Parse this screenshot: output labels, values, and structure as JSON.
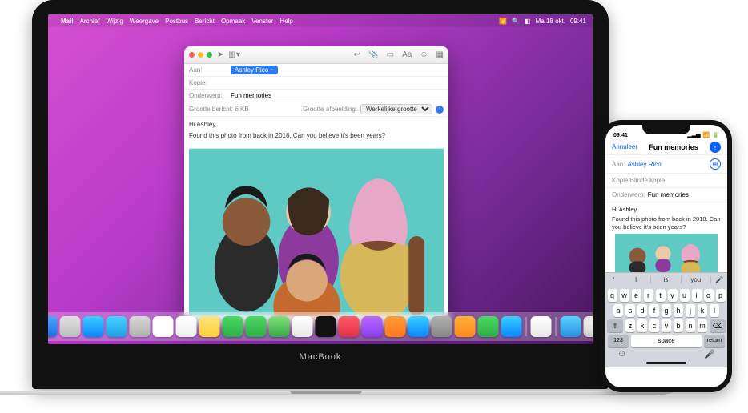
{
  "mac": {
    "menubar": {
      "apple": "",
      "app": "Mail",
      "items": [
        "Archief",
        "Wijzig",
        "Weergave",
        "Postbus",
        "Bericht",
        "Opmaak",
        "Venster",
        "Help"
      ],
      "status": {
        "wifi": "📶",
        "search": "🔍",
        "cc": "◧",
        "date": "Ma 18 okt.",
        "time": "09:41"
      }
    },
    "compose": {
      "toolbar": {
        "send": "➤",
        "dropdown": "▾",
        "reply": "↩︎",
        "attach": "📎",
        "photo": "▭",
        "format": "Aa",
        "emoji": "☺",
        "more": "…"
      },
      "to_label": "Aan:",
      "to_chip": "Ashley Rico ~",
      "cc_label": "Kopie:",
      "subject_label": "Onderwerp:",
      "subject_value": "Fun memories",
      "msg_size_label": "Grootte bericht: 6 KB",
      "img_size_label": "Grootte afbeelding:",
      "img_size_value": "Werkelijke grootte",
      "greeting": "Hi Ashley,",
      "line": "Found this photo from back in 2018. Can you believe it's been years?"
    },
    "brand": "MacBook",
    "dock_apps": [
      "finder",
      "launchpad",
      "safari",
      "mail",
      "contacts",
      "calendar",
      "reminders",
      "notes",
      "facetime",
      "messages",
      "maps",
      "photos",
      "tv",
      "music",
      "podcasts",
      "books",
      "appstore",
      "settings",
      "pages",
      "numbers",
      "keynote",
      "preview",
      "terminal"
    ]
  },
  "iphone": {
    "status": {
      "time": "09:41",
      "sig": "▂▃▅",
      "wifi": "📶",
      "bat": "🔋"
    },
    "nav": {
      "cancel": "Annuleer",
      "title": "Fun memories",
      "send": "↑"
    },
    "to_label": "Aan:",
    "to_value": "Ashley Rico",
    "add": "⊕",
    "cc_label": "Kopie/Blinde kopie:",
    "subj_label": "Onderwerp:",
    "subj_value": "Fun memories",
    "greeting": "Hi Ashley,",
    "body": "Found this photo from back in 2018. Can you believe it's been years?",
    "predict": {
      "q": "“",
      "w1": "I",
      "w2": "is",
      "w3": "you",
      "mic": "🎤"
    },
    "keys_r1": [
      "q",
      "w",
      "e",
      "r",
      "t",
      "y",
      "u",
      "i",
      "o",
      "p"
    ],
    "keys_r2": [
      "a",
      "s",
      "d",
      "f",
      "g",
      "h",
      "j",
      "k",
      "l"
    ],
    "keys_r3": [
      "z",
      "x",
      "c",
      "v",
      "b",
      "n",
      "m"
    ],
    "shift": "⇧",
    "bksp": "⌫",
    "numkey": "123",
    "space": "space",
    "ret": "return",
    "emoji": "☺",
    "mic": "🎤"
  }
}
